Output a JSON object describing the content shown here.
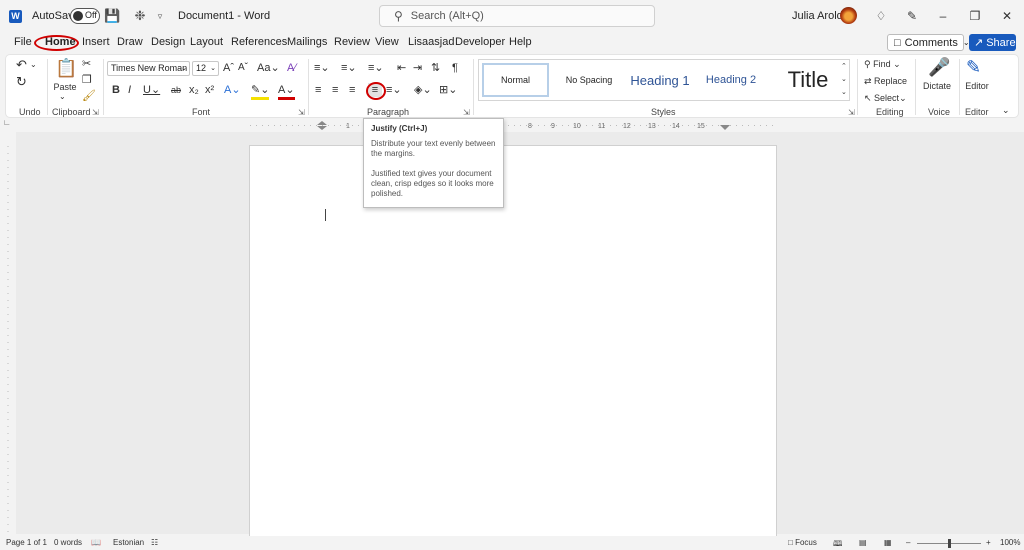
{
  "titlebar": {
    "autosave_label": "AutoSave",
    "autosave_state": "Off",
    "doc_title": "Document1  -  Word",
    "search_placeholder": "Search (Alt+Q)",
    "user_name": "Julia Arold"
  },
  "tabs": [
    "File",
    "Home",
    "Insert",
    "Draw",
    "Design",
    "Layout",
    "References",
    "Mailings",
    "Review",
    "View",
    "Lisaasjad",
    "Developer",
    "Help"
  ],
  "comments_label": "Comments",
  "share_label": "Share",
  "ribbon": {
    "undo_label": "Undo",
    "clipboard_label": "Clipboard",
    "paste_label": "Paste",
    "font_label": "Font",
    "font_name": "Times New Roman",
    "font_size": "12",
    "paragraph_label": "Paragraph",
    "styles_label": "Styles",
    "style_normal": "Normal",
    "style_no_spacing": "No Spacing",
    "style_heading1": "Heading 1",
    "style_heading2": "Heading 2",
    "style_title": "Title",
    "find_label": "Find",
    "replace_label": "Replace",
    "select_label": "Select",
    "editing_label": "Editing",
    "dictate_label": "Dictate",
    "voice_label": "Voice",
    "editor_label": "Editor",
    "editor_group_label": "Editor"
  },
  "tooltip": {
    "title": "Justify (Ctrl+J)",
    "line1": "Distribute your text evenly between the margins.",
    "line2": "Justified text gives your document clean, crisp edges so it looks more polished."
  },
  "ruler_numbers": [
    "1",
    "8",
    "9",
    "10",
    "11",
    "12",
    "13",
    "14",
    "15"
  ],
  "status": {
    "page": "Page 1 of 1",
    "words": "0 words",
    "language": "Estonian",
    "focus": "Focus",
    "zoom": "100%"
  },
  "colors": {
    "accent": "#185abd",
    "annotation": "#d00000"
  }
}
